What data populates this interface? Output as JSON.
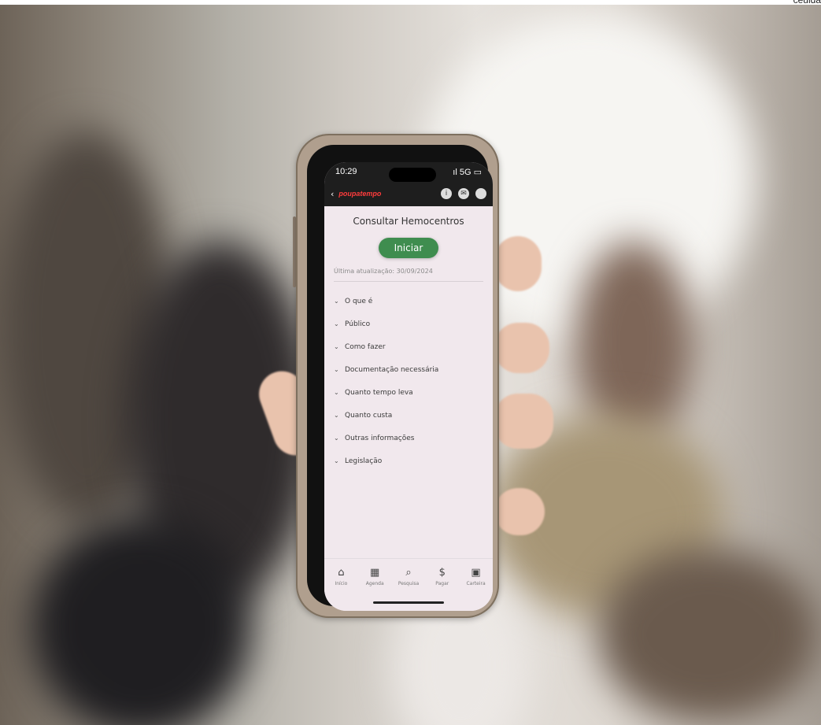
{
  "credit": "ceuida",
  "status_bar": {
    "time": "10:29",
    "signal": "ıl",
    "network": "5G",
    "battery": "▭"
  },
  "app_bar": {
    "back_icon": "chevron-left-icon",
    "logo_text": "poupatempo",
    "icons": [
      "info-icon",
      "mail-icon",
      "profile-icon"
    ]
  },
  "page": {
    "title": "Consultar Hemocentros",
    "start_button": "Iniciar",
    "updated": "Última atualização: 30/09/2024"
  },
  "sections": [
    "O que é",
    "Público",
    "Como fazer",
    "Documentação necessária",
    "Quanto tempo leva",
    "Quanto custa",
    "Outras informações",
    "Legislação"
  ],
  "bottom_nav": [
    {
      "label": "Início",
      "icon": "home-icon"
    },
    {
      "label": "Agenda",
      "icon": "calendar-icon"
    },
    {
      "label": "Pesquisa",
      "icon": "search-icon"
    },
    {
      "label": "Pagar",
      "icon": "dollar-icon"
    },
    {
      "label": "Carteira",
      "icon": "wallet-icon"
    }
  ],
  "colors": {
    "button": "#3f8d4f",
    "screen_bg": "#f1e8ed",
    "app_bar_bg": "#1e1e1e",
    "logo": "#ff3c3c"
  }
}
